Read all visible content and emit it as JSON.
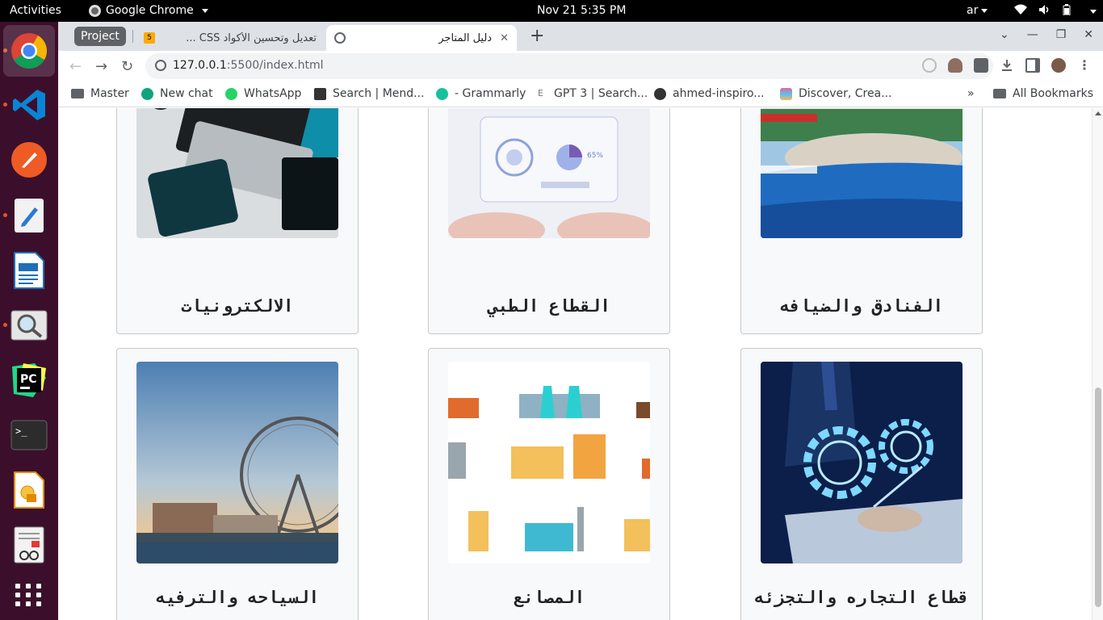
{
  "os": {
    "activities": "Activities",
    "app_menu": "Google Chrome",
    "clock": "Nov 21   5:35 PM",
    "language": "ar"
  },
  "browser": {
    "tab_group": "Project",
    "tabs": [
      {
        "title": "تعديل وتحسين الأكواد CSS ...",
        "favicon": "5"
      },
      {
        "title": "دليل المتاجر"
      }
    ],
    "url_host": "127.0.0.1",
    "url_rest": ":5500/index.html",
    "bookmarks": [
      {
        "label": "Master",
        "icon": "folder-icon"
      },
      {
        "label": "New chat",
        "icon": "openai-icon"
      },
      {
        "label": "WhatsApp",
        "icon": "whatsapp-icon"
      },
      {
        "label": "Search | Mend...",
        "icon": "mendeley-icon"
      },
      {
        "label": "- Grammarly",
        "icon": "grammarly-icon"
      },
      {
        "label": "GPT 3 | Search...",
        "icon": "e-icon"
      },
      {
        "label": "ahmed-inspiro...",
        "icon": "github-icon"
      },
      {
        "label": "Discover, Crea...",
        "icon": "layers-icon"
      }
    ],
    "all_bookmarks": "All Bookmarks"
  },
  "page": {
    "cards": [
      {
        "label": "الالكترونيات",
        "image": "electronics-laptop"
      },
      {
        "label": "القطاع الطبي",
        "image": "medical-infographic"
      },
      {
        "label": "الفنادق والضيافه",
        "image": "hotel-pool"
      },
      {
        "label": "السياحه والترفيه",
        "image": "tourism-ferris-wheel"
      },
      {
        "label": "المصانع",
        "image": "factories-illustration"
      },
      {
        "label": "قطاع التجاره والتجزئه",
        "image": "business-gears"
      }
    ]
  },
  "colors": {
    "dock_bg": "#3b0f2b",
    "topbar_bg": "#000000",
    "card_bg": "#f8f9fa",
    "card_border": "#c8c8c8"
  }
}
